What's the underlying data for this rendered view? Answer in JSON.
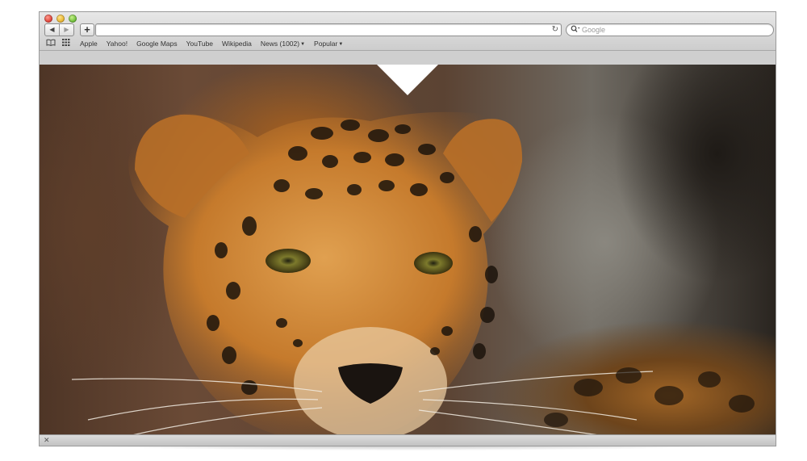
{
  "browser": {
    "back_glyph": "◀",
    "forward_glyph": "▶",
    "new_tab_glyph": "+",
    "reload_glyph": "↻",
    "search": {
      "placeholder": "Google",
      "icon": "search-icon"
    }
  },
  "bookmarks": {
    "reading_list_icon": "book-icon",
    "top_sites_icon": "grid-icon",
    "items": [
      {
        "label": "Apple"
      },
      {
        "label": "Yahoo!"
      },
      {
        "label": "Google Maps"
      },
      {
        "label": "YouTube"
      },
      {
        "label": "Wikipedia"
      },
      {
        "label": "News (1002)",
        "dropdown": true
      },
      {
        "label": "Popular",
        "dropdown": true
      }
    ]
  },
  "content": {
    "image_subject": "leopard photograph"
  },
  "colors": {
    "chrome_light": "#e7e7e7",
    "chrome_dark": "#cdcdcd",
    "close": "#e0443a",
    "minimize": "#e8b531",
    "zoom": "#6fbe3a"
  }
}
